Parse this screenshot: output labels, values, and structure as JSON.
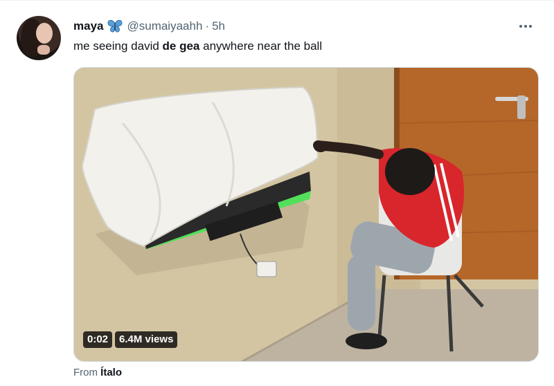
{
  "tweet": {
    "author_name": "maya",
    "butterfly_icon": "butterfly-emoji",
    "handle": "@sumaiyaahh",
    "separator": "·",
    "time": "5h",
    "text_before": "me seeing david ",
    "text_bold": "de gea",
    "text_after": " anywhere near the ball",
    "more_icon": "more-options-icon"
  },
  "video": {
    "time": "0:02",
    "views": "6.4M views"
  },
  "attribution": {
    "prefix": "From ",
    "source": "Ítalo"
  },
  "colors": {
    "accent_green": "#52e05a",
    "jersey_red": "#d8262c",
    "door_brown": "#b86a2a",
    "wall_beige": "#d9cba8"
  }
}
